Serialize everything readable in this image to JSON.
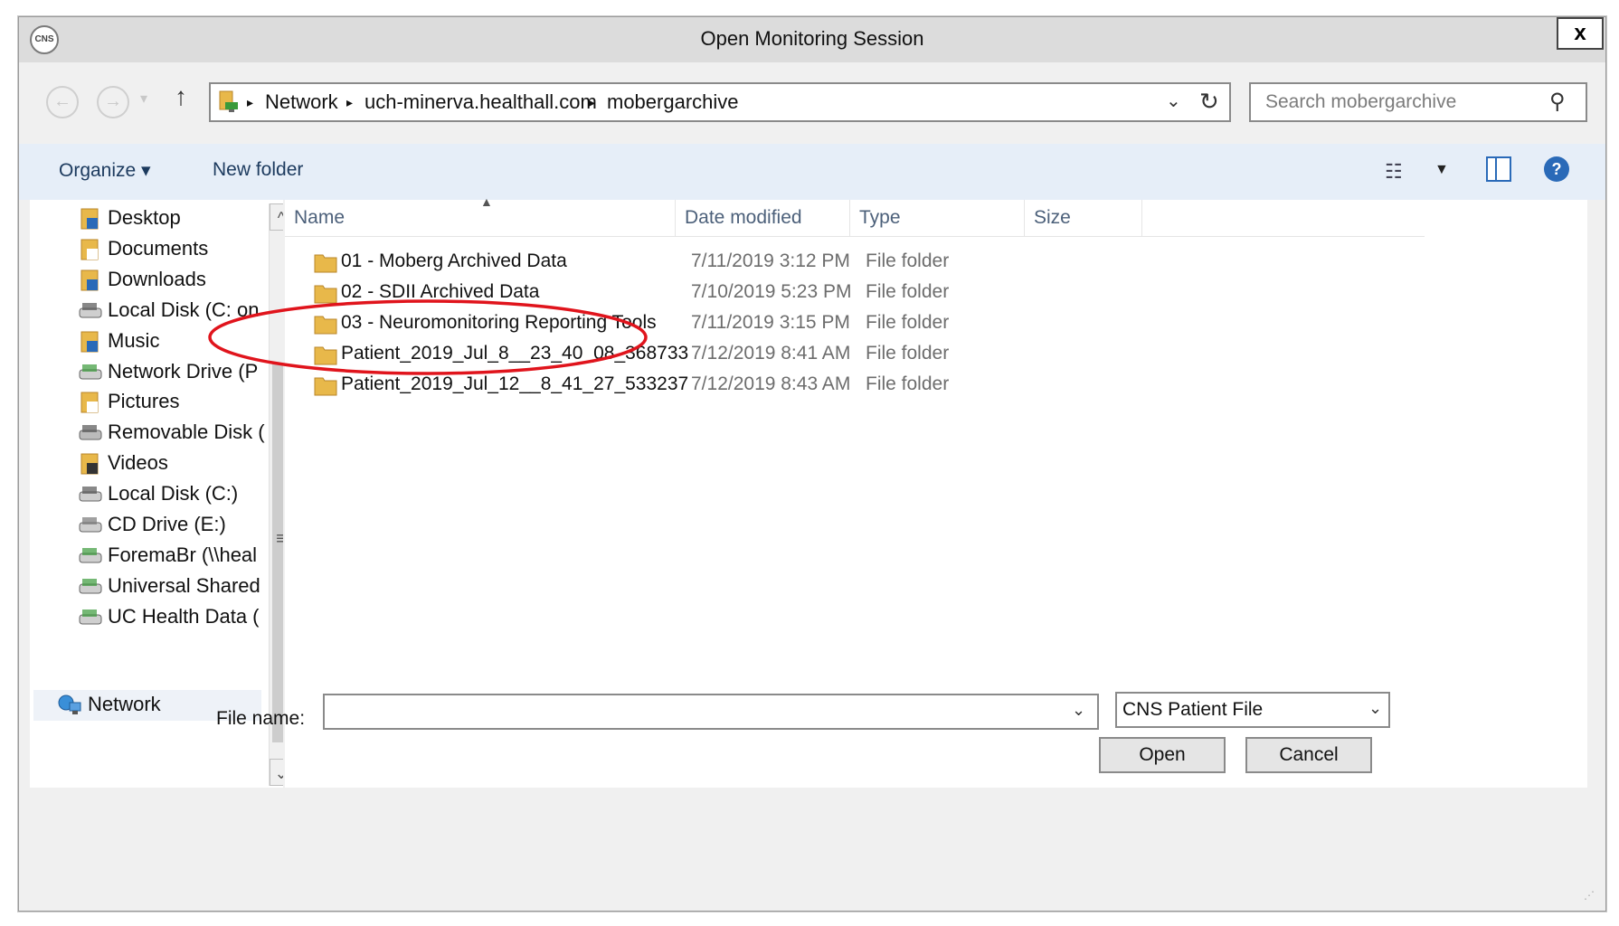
{
  "window": {
    "title": "Open Monitoring Session",
    "close_label": "x",
    "app_icon_text": "CNS"
  },
  "address": {
    "crumbs": [
      "Network",
      "uch-minerva.healthall.com",
      "mobergarchive"
    ],
    "arrow": "▸"
  },
  "search": {
    "placeholder": "Search mobergarchive"
  },
  "toolbar": {
    "organize_label": "Organize ▾",
    "new_folder_label": "New folder"
  },
  "nav": {
    "items": [
      {
        "label": "Desktop",
        "icon": "desktop-folder-icon"
      },
      {
        "label": "Documents",
        "icon": "documents-icon"
      },
      {
        "label": "Downloads",
        "icon": "downloads-icon"
      },
      {
        "label": "Local Disk (C: on",
        "icon": "local-disk-icon"
      },
      {
        "label": "Music",
        "icon": "music-icon"
      },
      {
        "label": "Network Drive (P",
        "icon": "network-drive-icon"
      },
      {
        "label": "Pictures",
        "icon": "pictures-icon"
      },
      {
        "label": "Removable Disk (",
        "icon": "removable-disk-icon"
      },
      {
        "label": "Videos",
        "icon": "videos-icon"
      },
      {
        "label": "Local Disk (C:)",
        "icon": "local-disk-icon"
      },
      {
        "label": "CD Drive (E:)",
        "icon": "cd-drive-icon"
      },
      {
        "label": "ForemaBr (\\\\heal",
        "icon": "network-drive-icon"
      },
      {
        "label": "Universal Shared",
        "icon": "network-drive-icon"
      },
      {
        "label": "UC Health Data (",
        "icon": "network-drive-icon"
      }
    ],
    "network_label": "Network"
  },
  "columns": {
    "name": "Name",
    "date": "Date modified",
    "type": "Type",
    "size": "Size"
  },
  "files": [
    {
      "name": "01 - Moberg Archived Data",
      "date": "7/11/2019 3:12 PM",
      "type": "File folder"
    },
    {
      "name": "02 - SDII Archived Data",
      "date": "7/10/2019 5:23 PM",
      "type": "File folder"
    },
    {
      "name": "03 - Neuromonitoring Reporting Tools",
      "date": "7/11/2019 3:15 PM",
      "type": "File folder"
    },
    {
      "name": "Patient_2019_Jul_8__23_40_08_368733",
      "date": "7/12/2019 8:41 AM",
      "type": "File folder"
    },
    {
      "name": "Patient_2019_Jul_12__8_41_27_533237",
      "date": "7/12/2019 8:43 AM",
      "type": "File folder"
    }
  ],
  "bottom": {
    "filename_label": "File name:",
    "filename_value": "",
    "filetype_value": "CNS Patient File",
    "open_label": "Open",
    "cancel_label": "Cancel"
  },
  "colors": {
    "annotation": "#e0141c",
    "toolbar_bg": "#e6eef8",
    "folder": "#e8b84a"
  }
}
